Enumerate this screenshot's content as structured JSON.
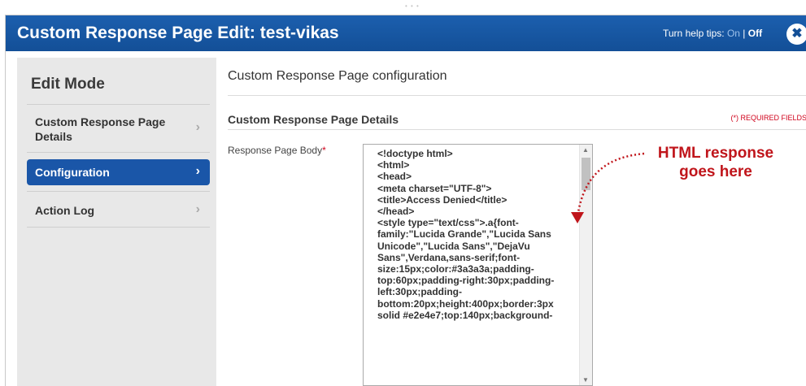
{
  "window": {
    "title": "Custom Response Page Edit: test-vikas",
    "help_prefix": "Turn help tips:",
    "help_on": "On",
    "help_sep": "|",
    "help_off": "Off",
    "close": "✖"
  },
  "sidebar": {
    "heading": "Edit Mode",
    "items": [
      {
        "label": "Custom Response Page Details"
      },
      {
        "label": "Configuration"
      },
      {
        "label": "Action Log"
      }
    ],
    "chevron": "›"
  },
  "main": {
    "section_title": "Custom Response Page configuration",
    "details_title": "Custom Response Page Details",
    "required_note": "(*) REQUIRED FIELDS",
    "field_label": "Response Page Body",
    "field_required": "*",
    "body_value": "<!doctype html>\n<html>\n<head>\n<meta charset=\"UTF-8\">\n<title>Access Denied</title>\n</head>\n<style type=\"text/css\">.a{font-family:\"Lucida Grande\",\"Lucida Sans Unicode\",\"Lucida Sans\",\"DejaVu Sans\",Verdana,sans-serif;font-size:15px;color:#3a3a3a;padding-top:60px;padding-right:30px;padding-left:30px;padding-bottom:20px;height:400px;border:3px solid #e2e4e7;top:140px;background-"
  },
  "annotation": {
    "line1": "HTML response",
    "line2": "goes here",
    "color": "#c0151b"
  },
  "colors": {
    "titlebar": "#1a5aa6",
    "active": "#1a56a8",
    "sidebar_bg": "#e8e8e8"
  }
}
